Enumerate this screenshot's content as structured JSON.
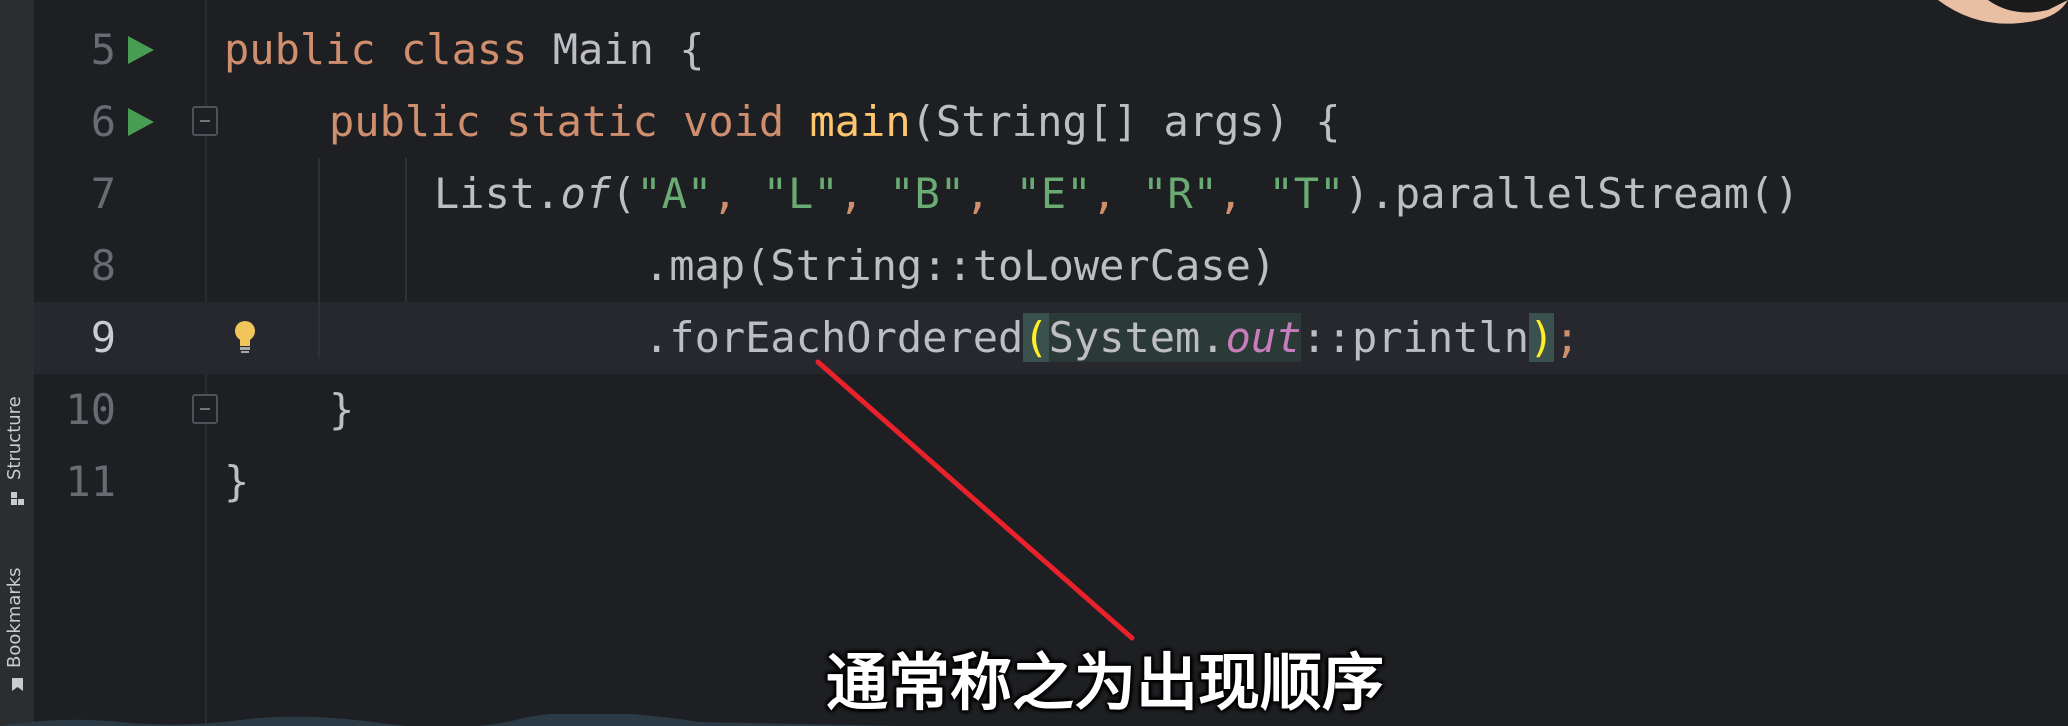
{
  "toolstrip": {
    "items": [
      {
        "label": "Structure",
        "icon": "structure-icon"
      },
      {
        "label": "Bookmarks",
        "icon": "bookmark-icon"
      }
    ]
  },
  "editor": {
    "lines": [
      {
        "num": "5",
        "has_run": true,
        "has_fold": false,
        "current": false
      },
      {
        "num": "6",
        "has_run": true,
        "has_fold": true,
        "current": false
      },
      {
        "num": "7",
        "has_run": false,
        "has_fold": false,
        "current": false
      },
      {
        "num": "8",
        "has_run": false,
        "has_fold": false,
        "current": false
      },
      {
        "num": "9",
        "has_run": false,
        "has_fold": false,
        "current": true,
        "has_bulb": true
      },
      {
        "num": "10",
        "has_run": false,
        "has_fold": true,
        "current": false
      },
      {
        "num": "11",
        "has_run": false,
        "has_fold": false,
        "current": false
      }
    ],
    "code": {
      "l5_kw1": "public",
      "l5_kw2": "class",
      "l5_name": "Main",
      "l5_brace": "{",
      "l6_kw1": "public",
      "l6_kw2": "static",
      "l6_kw3": "void",
      "l6_method": "main",
      "l6_params": "(String[] args)",
      "l6_brace": "{",
      "l7_list": "List.",
      "l7_of": "of",
      "l7_open": "(",
      "l7_s1": "\"A\"",
      "l7_s2": "\"L\"",
      "l7_s3": "\"B\"",
      "l7_s4": "\"E\"",
      "l7_s5": "\"R\"",
      "l7_s6": "\"T\"",
      "l7_comma": ", ",
      "l7_tail": ").parallelStream()",
      "l8": ".map(String::toLowerCase)",
      "l9_method": ".forEachOrdered",
      "l9_open": "(",
      "l9_sys": "System.",
      "l9_out": "out",
      "l9_println": "::println",
      "l9_close": ")",
      "l9_semi": ";",
      "l10": "}",
      "l11": "}"
    }
  },
  "subtitle": "通常称之为出现顺序",
  "colors": {
    "background": "#1e1f22",
    "keyword": "#cf8e6d",
    "string": "#6aab73",
    "method_decl": "#ffc66d",
    "field": "#c77dbb",
    "annotation": "#e8212b",
    "run_icon": "#499c54"
  }
}
